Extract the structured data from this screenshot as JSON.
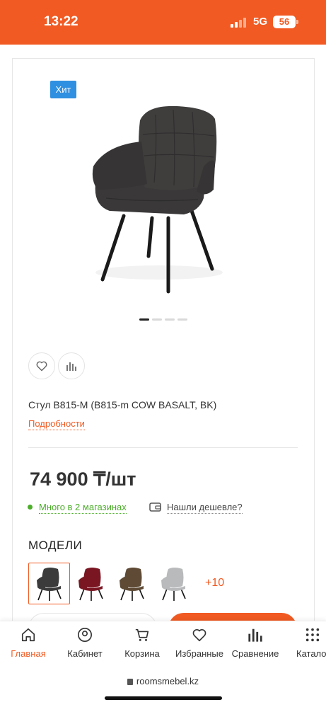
{
  "status_bar": {
    "time": "13:22",
    "network": "5G",
    "battery": "56"
  },
  "product": {
    "badge": "Хит",
    "title": "Стул B815-M (B815-m COW BASALT, BK)",
    "details_link": "Подробности",
    "price": "74 900 ₸/шт",
    "stock": "Много в 2 магазинах",
    "cheaper": "Нашли дешевле?",
    "gallery_total": 4,
    "gallery_active": 0
  },
  "models": {
    "title": "МОДЕЛИ",
    "thumbs": [
      {
        "name": "model-dark-grey",
        "color": "#3b3b3b"
      },
      {
        "name": "model-burgundy",
        "color": "#7a1622"
      },
      {
        "name": "model-brown",
        "color": "#5e4a35"
      },
      {
        "name": "model-light-grey",
        "color": "#b8babb"
      }
    ],
    "more": "+10"
  },
  "bottom_nav": [
    {
      "label": "Главная",
      "icon": "home-icon",
      "active": true
    },
    {
      "label": "Кабинет",
      "icon": "user-icon",
      "active": false
    },
    {
      "label": "Корзина",
      "icon": "cart-icon",
      "active": false
    },
    {
      "label": "Избранные",
      "icon": "heart-icon",
      "active": false
    },
    {
      "label": "Сравнение",
      "icon": "compare-icon",
      "active": false
    },
    {
      "label": "Катало",
      "icon": "catalog-icon",
      "active": false
    }
  ],
  "browser": {
    "url": "roomsmebel.kz"
  },
  "colors": {
    "accent": "#f15a22",
    "badge": "#2f8fe0",
    "stock": "#4cae2a"
  }
}
